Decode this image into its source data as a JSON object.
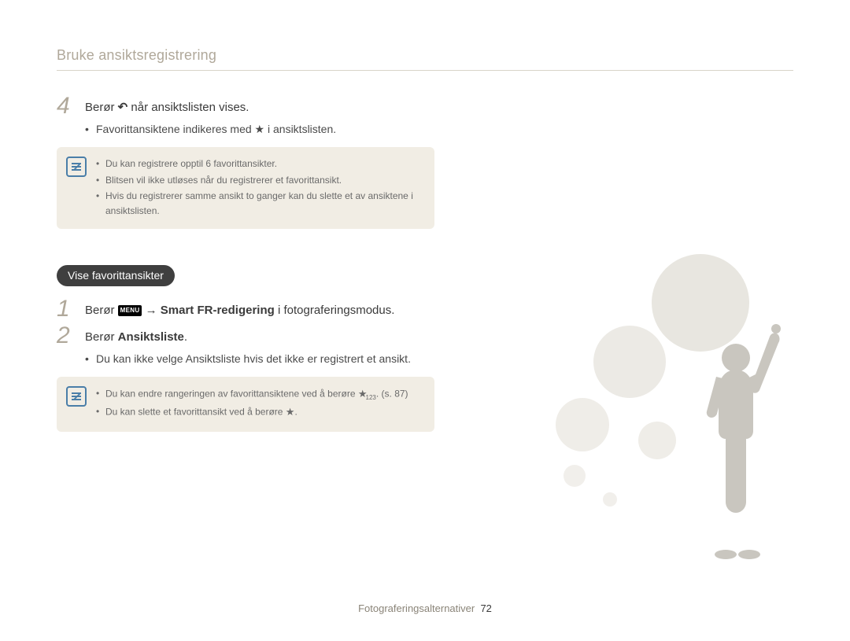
{
  "breadcrumb": "Bruke ansiktsregistrering",
  "step4": {
    "num": "4",
    "prefix": "Berør ",
    "suffix": " når ansiktslisten vises.",
    "bullet_pre": "Favorittansiktene indikeres med ",
    "bullet_post": " i ansiktslisten."
  },
  "note1": {
    "items": [
      "Du kan registrere opptil 6 favorittansikter.",
      "Blitsen vil ikke utløses når du registrerer et favorittansikt.",
      "Hvis du registrerer samme ansikt to ganger kan du slette et av ansiktene i ansiktslisten."
    ]
  },
  "section_title": "Vise favorittansikter",
  "step1": {
    "num": "1",
    "prefix": "Berør ",
    "menu_label": "MENU",
    "arrow": " → ",
    "bold1": "Smart FR-redigering",
    "suffix": " i fotograferingsmodus."
  },
  "step2": {
    "num": "2",
    "prefix": "Berør ",
    "bold1": "Ansiktsliste",
    "suffix": ".",
    "bullet_pre": "Du kan ikke velge ",
    "bullet_bold": "Ansiktsliste",
    "bullet_post": " hvis det ikke er registrert et ansikt."
  },
  "note2": {
    "item1_pre": "Du kan endre rangeringen av favorittansiktene ved å berøre ",
    "item1_sub": "123",
    "item1_post": ". (s. 87)",
    "item2_pre": "Du kan slette et favorittansikt ved å berøre ",
    "item2_post": "."
  },
  "footer": {
    "section": "Fotograferingsalternativer",
    "page": "72"
  }
}
